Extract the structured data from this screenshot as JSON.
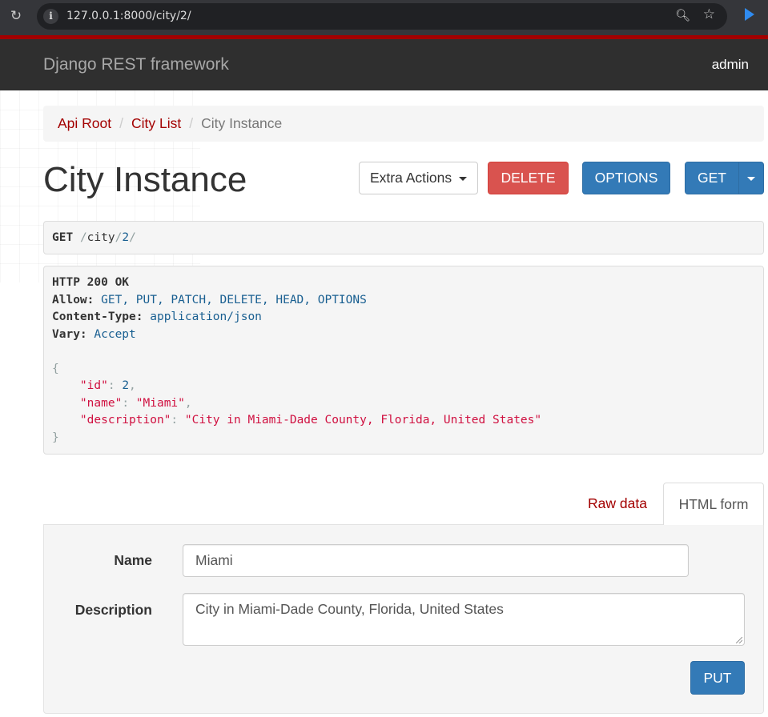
{
  "browser": {
    "url": "127.0.0.1:8000/city/2/"
  },
  "navbar": {
    "brand": "Django REST framework",
    "user": "admin"
  },
  "breadcrumb": {
    "items": [
      "Api Root",
      "City List"
    ],
    "active": "City Instance",
    "separator": "/"
  },
  "page": {
    "title": "City Instance"
  },
  "actions": {
    "extra": "Extra Actions",
    "delete": "DELETE",
    "options": "OPTIONS",
    "get": "GET"
  },
  "request": {
    "method": "GET",
    "path_parts": [
      "/",
      "city",
      "/",
      "2",
      "/"
    ]
  },
  "response": {
    "status": "HTTP 200 OK",
    "headers": [
      {
        "key": "Allow:",
        "value": "GET, PUT, PATCH, DELETE, HEAD, OPTIONS"
      },
      {
        "key": "Content-Type:",
        "value": "application/json"
      },
      {
        "key": "Vary:",
        "value": "Accept"
      }
    ],
    "body": {
      "open": "{",
      "close": "}",
      "id_key": "\"id\"",
      "id_value": "2",
      "name_key": "\"name\"",
      "name_value": "\"Miami\"",
      "desc_key": "\"description\"",
      "desc_value": "\"City in Miami-Dade County, Florida, United States\""
    }
  },
  "tabs": {
    "raw": "Raw data",
    "html": "HTML form"
  },
  "form": {
    "name_label": "Name",
    "name_value": "Miami",
    "desc_label": "Description",
    "desc_value": "City in Miami-Dade County, Florida, United States",
    "submit": "PUT"
  },
  "colors": {
    "accent": "#a30000",
    "primary": "#337ab7",
    "danger": "#d9534f"
  }
}
